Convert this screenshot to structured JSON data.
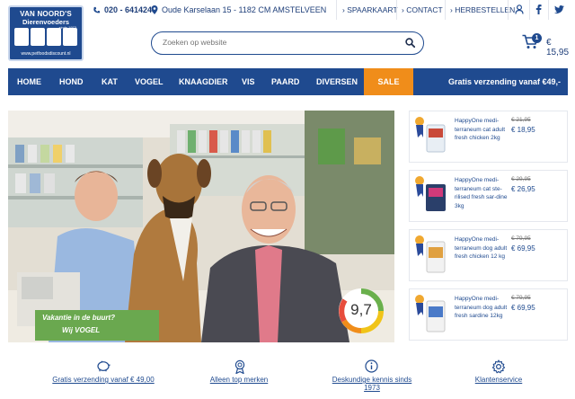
{
  "logo": {
    "name_line1": "VAN NOORD'S",
    "name_line2": "Dierenvoeders",
    "since": "sinds 1973",
    "url": "www.petfoodsdiscount.nl"
  },
  "topbar": {
    "phone": "020 - 6414243",
    "address": "Oude Karselaan 15 - 1182 CM AMSTELVEEN",
    "links": [
      "SPAARKAART",
      "CONTACT",
      "HERBESTELLEN"
    ]
  },
  "search": {
    "placeholder": "Zoeken op website"
  },
  "cart": {
    "count": "1",
    "total": "€ 15,95"
  },
  "nav": {
    "items": [
      "HOME",
      "HOND",
      "KAT",
      "VOGEL",
      "KNAAGDIER",
      "VIS",
      "PAARD",
      "DIVERSEN",
      "SALE"
    ],
    "free_shipping": "Gratis verzending vanaf €49,-"
  },
  "hero": {
    "rating": "9,7",
    "sign_line1": "Vakantie in de buurt?",
    "sign_line2": "Wij VOGEL"
  },
  "products": [
    {
      "name": "HappyOne medi-terraneum cat adult fresh chicken 2kg",
      "old_price": "€ 21,95",
      "price": "€ 18,95"
    },
    {
      "name": "HappyOne medi-terraneum cat ste-rilised fresh sar-dine 3kg",
      "old_price": "€ 29,95",
      "price": "€ 26,95"
    },
    {
      "name": "HappyOne medi-terraneum dog adult fresh chicken 12 kg",
      "old_price": "€ 79,95",
      "price": "€ 69,95"
    },
    {
      "name": "HappyOne medi-terraneum dog adult fresh sardine 12kg",
      "old_price": "€ 79,95",
      "price": "€ 69,95"
    }
  ],
  "usps": [
    {
      "label": "Gratis verzending vanaf € 49,00",
      "icon": "piggy-bank-icon"
    },
    {
      "label": "Alleen top merken",
      "icon": "award-icon"
    },
    {
      "label": "Deskundige kennis sinds 1973",
      "icon": "info-icon"
    },
    {
      "label": "Klantenservice",
      "icon": "gear-icon"
    }
  ],
  "colors": {
    "brand": "#1f4a8f",
    "accent": "#f08d1a"
  }
}
